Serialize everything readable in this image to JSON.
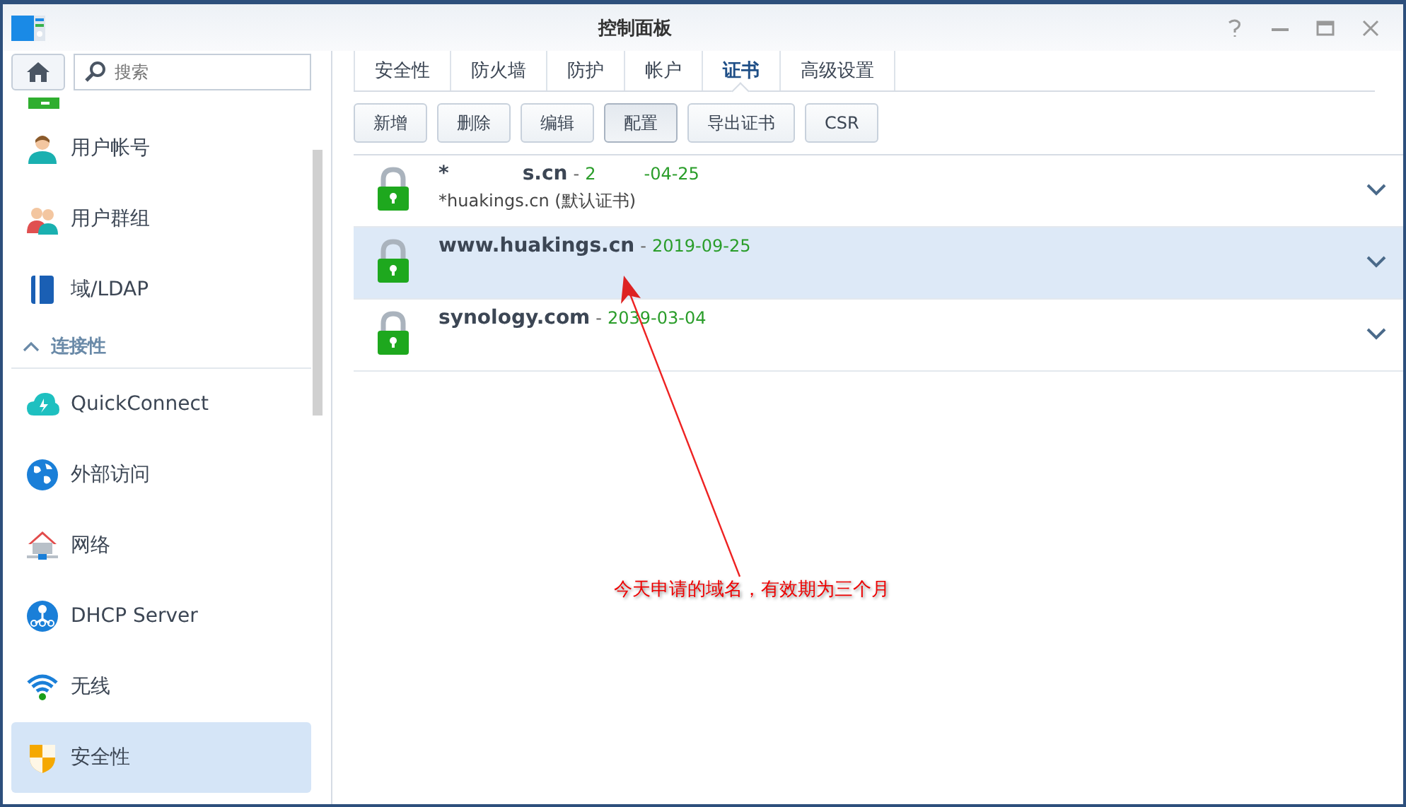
{
  "window": {
    "title": "控制面板"
  },
  "search": {
    "placeholder": "搜索"
  },
  "sidebar": {
    "items": [
      {
        "kind": "item",
        "label": "用户帐号",
        "selected": false
      },
      {
        "kind": "item",
        "label": "用户群组",
        "selected": false
      },
      {
        "kind": "item",
        "label": "域/LDAP",
        "selected": false
      },
      {
        "kind": "section",
        "label": "连接性",
        "expanded": true
      },
      {
        "kind": "item",
        "label": "QuickConnect",
        "selected": false
      },
      {
        "kind": "item",
        "label": "外部访问",
        "selected": false
      },
      {
        "kind": "item",
        "label": "网络",
        "selected": false
      },
      {
        "kind": "item",
        "label": "DHCP Server",
        "selected": false
      },
      {
        "kind": "item",
        "label": "无线",
        "selected": false
      },
      {
        "kind": "item",
        "label": "安全性",
        "selected": true
      }
    ]
  },
  "tabs": [
    {
      "label": "安全性",
      "selected": false
    },
    {
      "label": "防火墙",
      "selected": false
    },
    {
      "label": "防护",
      "selected": false
    },
    {
      "label": "帐户",
      "selected": false
    },
    {
      "label": "证书",
      "selected": true
    },
    {
      "label": "高级设置",
      "selected": false
    }
  ],
  "toolbar": [
    {
      "label": "新增",
      "pressed": false
    },
    {
      "label": "删除",
      "pressed": false
    },
    {
      "label": "编辑",
      "pressed": false
    },
    {
      "label": "配置",
      "pressed": true
    },
    {
      "label": "导出证书",
      "pressed": false
    },
    {
      "label": "CSR",
      "pressed": false
    }
  ],
  "certificates": [
    {
      "name": [
        "*",
        "s.cn"
      ],
      "separator": "-",
      "date": [
        "2",
        "-04-25"
      ],
      "subtitle": "*huakings.cn (默认证书)",
      "selected": false
    },
    {
      "name": [
        "www.huakings.cn"
      ],
      "separator": "-",
      "date": [
        "2019-09-25"
      ],
      "selected": true
    },
    {
      "name": [
        "synology.com"
      ],
      "separator": "-",
      "date": [
        "2039-03-04"
      ],
      "selected": false
    }
  ],
  "annotation": {
    "text": "今天申请的域名，有效期为三个月"
  }
}
